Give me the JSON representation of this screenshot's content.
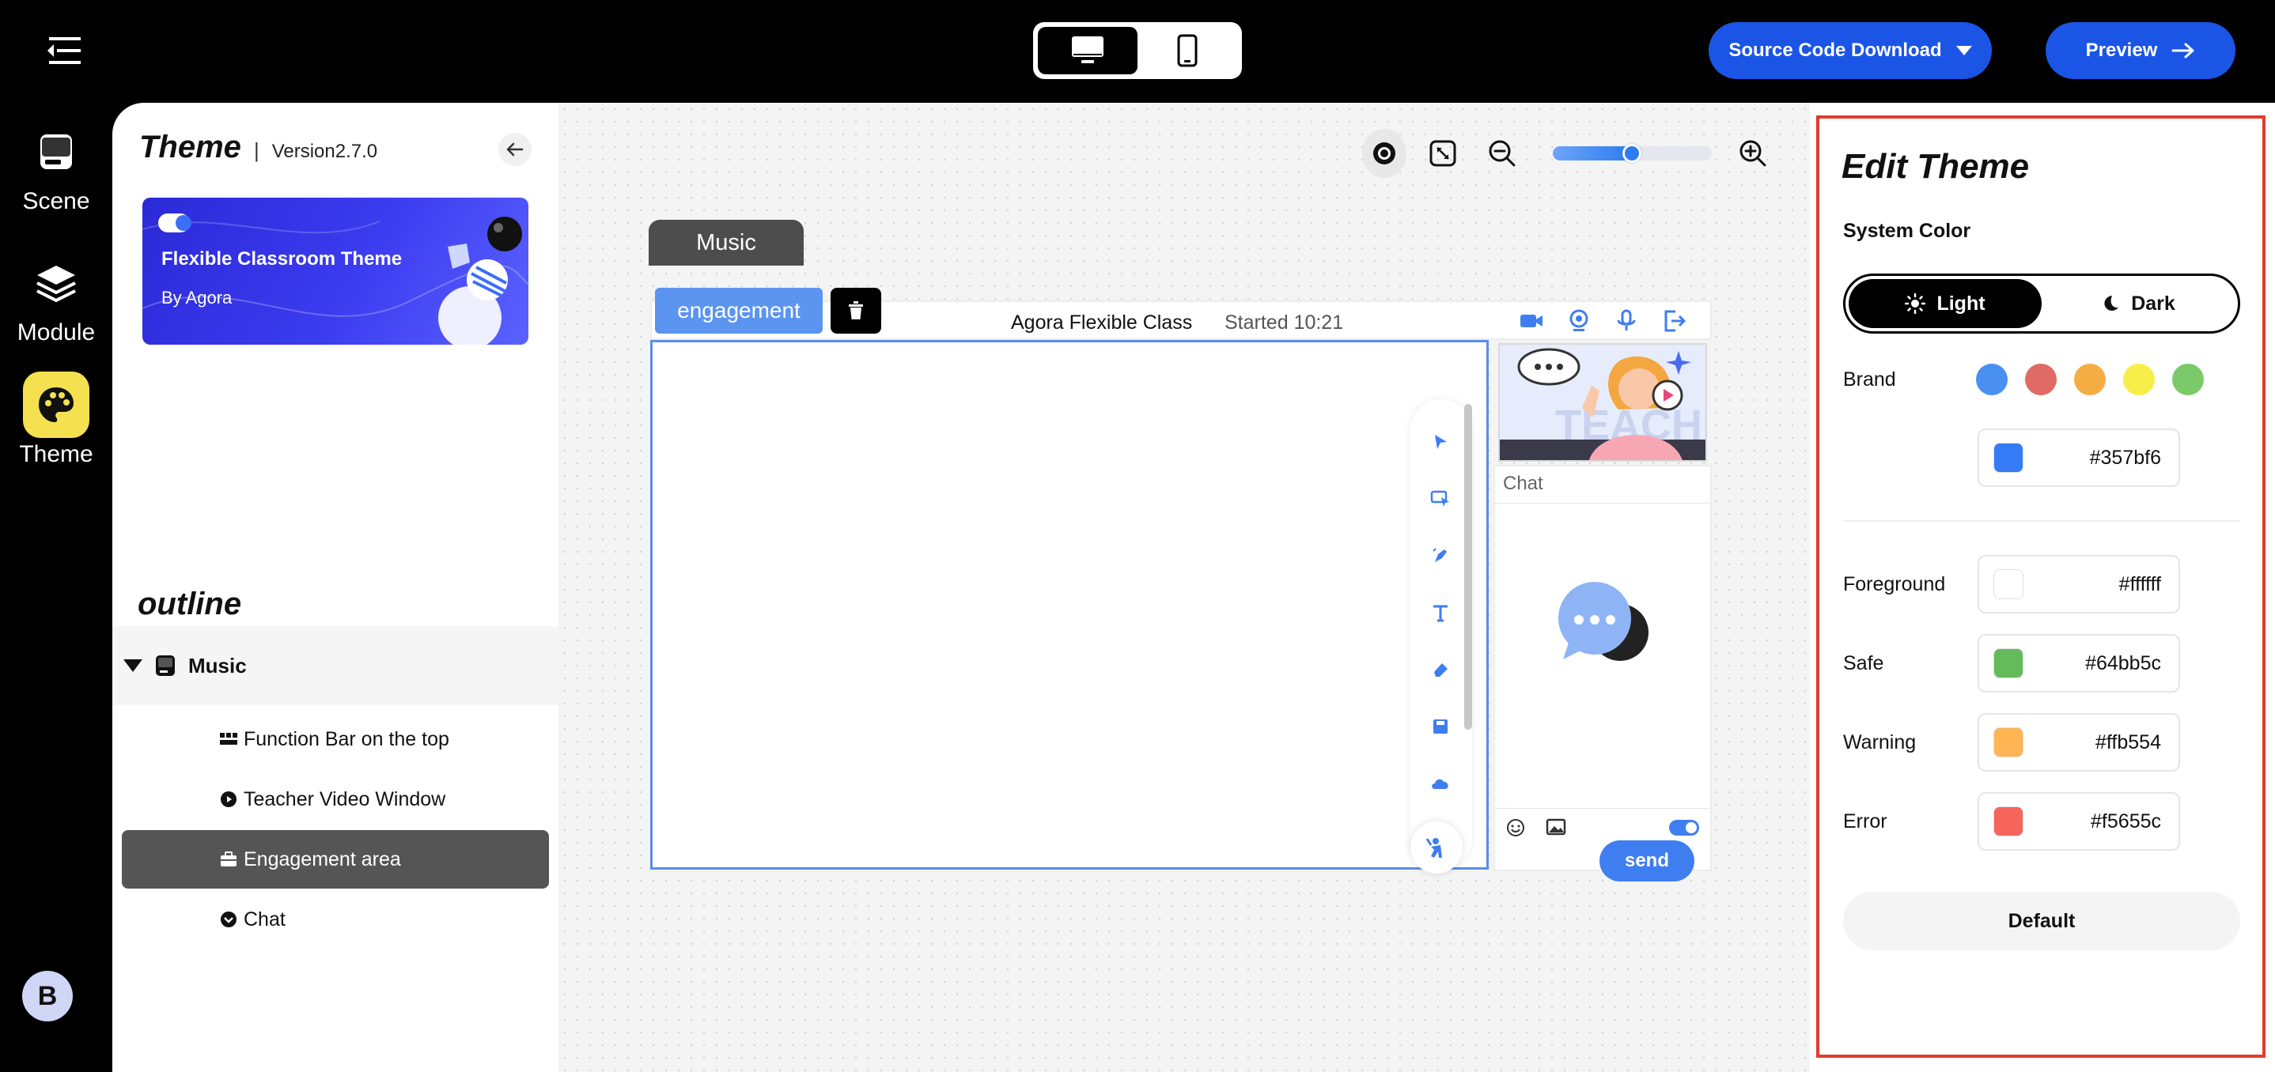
{
  "topbar": {
    "menu_icon": "menu-collapse-icon",
    "device_options": [
      "desktop-icon",
      "mobile-icon"
    ],
    "source_download_label": "Source Code Download",
    "preview_label": "Preview",
    "accent_color": "#1b55e6"
  },
  "rail": {
    "items": [
      {
        "label": "Scene",
        "icon": "scene-icon"
      },
      {
        "label": "Module",
        "icon": "layers-icon"
      },
      {
        "label": "Theme",
        "icon": "palette-icon",
        "active": true
      }
    ],
    "avatar_letter": "B"
  },
  "left_panel": {
    "title": "Theme",
    "separator": "|",
    "version": "Version2.7.0",
    "theme_card": {
      "name": "Flexible Classroom Theme",
      "author": "By Agora"
    },
    "outline_title": "outline",
    "outline_group": "Music",
    "outline_items": [
      {
        "label": "Function Bar on the top",
        "icon": "grid-icon"
      },
      {
        "label": "Teacher Video Window",
        "icon": "play-circle-icon"
      },
      {
        "label": "Engagement area",
        "icon": "briefcase-icon",
        "active": true
      },
      {
        "label": "Chat",
        "icon": "chat-circle-icon"
      }
    ]
  },
  "canvas": {
    "zoom_level": 0.5,
    "scene_tab": "Music",
    "engagement_tag": "engagement",
    "class_title": "Agora Flexible Class",
    "class_started": "Started 10:21",
    "chat_title": "Chat",
    "send_label": "send"
  },
  "edit_theme": {
    "title": "Edit Theme",
    "system_color_label": "System Color",
    "mode_light": "Light",
    "mode_dark": "Dark",
    "brand_label": "Brand",
    "brand_swatches": [
      "#4a90f0",
      "#e06a64",
      "#f4ad43",
      "#f8ee4a",
      "#7cc96a"
    ],
    "brand_hex": "#357bf6",
    "colors": [
      {
        "label": "Foreground",
        "hex": "#ffffff"
      },
      {
        "label": "Safe",
        "hex": "#64bb5c"
      },
      {
        "label": "Warning",
        "hex": "#ffb554"
      },
      {
        "label": "Error",
        "hex": "#f5655c"
      }
    ],
    "default_label": "Default",
    "highlight_color": "#e23c2c"
  }
}
